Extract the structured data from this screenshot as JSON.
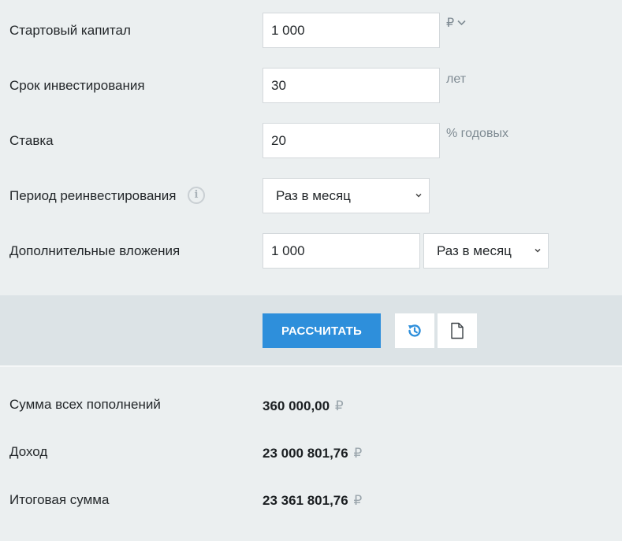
{
  "form": {
    "start_capital": {
      "label": "Стартовый капитал",
      "value": "1 000",
      "unit": "₽"
    },
    "term": {
      "label": "Срок инвестирования",
      "value": "30",
      "unit": "лет"
    },
    "rate": {
      "label": "Ставка",
      "value": "20",
      "unit": "% годовых"
    },
    "reinvest_period": {
      "label": "Период реинвестирования",
      "selected": "Раз в месяц"
    },
    "extra_contrib": {
      "label": "Дополнительные вложения",
      "value": "1 000",
      "period_selected": "Раз в месяц"
    }
  },
  "actions": {
    "calculate_label": "РАССЧИТАТЬ"
  },
  "results": {
    "total_contrib": {
      "label": "Сумма всех пополнений",
      "value": "360 000,00",
      "currency": "₽"
    },
    "income": {
      "label": "Доход",
      "value": "23 000 801,76",
      "currency": "₽"
    },
    "final_sum": {
      "label": "Итоговая сумма",
      "value": "23 361 801,76",
      "currency": "₽"
    }
  },
  "colors": {
    "accent": "#2e8fdb",
    "background": "#ebeff0",
    "action_bar": "#dce3e6",
    "muted_text": "#7f8b93"
  },
  "icons": [
    "chevron-down-icon",
    "info-icon",
    "history-icon",
    "document-icon"
  ]
}
